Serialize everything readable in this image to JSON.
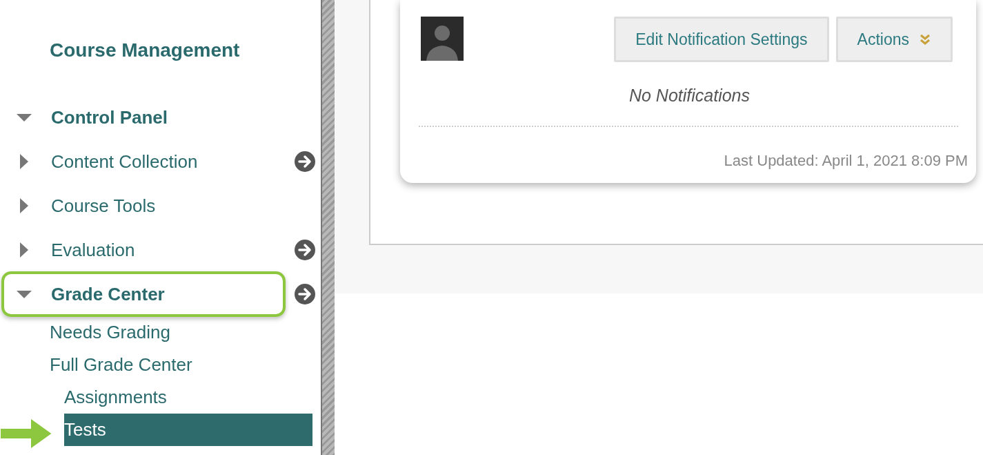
{
  "sidebar": {
    "title": "Course Management",
    "items": [
      {
        "label": "Control Panel",
        "expanded": true,
        "quick_link": false,
        "highlighted": false
      },
      {
        "label": "Content Collection",
        "expanded": false,
        "quick_link": true,
        "highlighted": false
      },
      {
        "label": "Course Tools",
        "expanded": false,
        "quick_link": false,
        "highlighted": false
      },
      {
        "label": "Evaluation",
        "expanded": false,
        "quick_link": true,
        "highlighted": false
      },
      {
        "label": "Grade Center",
        "expanded": true,
        "quick_link": true,
        "highlighted": true,
        "children": [
          {
            "label": "Needs Grading",
            "selected": false,
            "pointed": false
          },
          {
            "label": "Full Grade Center",
            "selected": false,
            "pointed": false,
            "children": [
              {
                "label": "Assignments",
                "selected": false,
                "pointed": false
              },
              {
                "label": "Tests",
                "selected": true,
                "pointed": true
              }
            ]
          }
        ]
      }
    ]
  },
  "notifications": {
    "buttons": [
      {
        "label": "Edit Notification Settings",
        "kind": "plain"
      },
      {
        "label": "Actions",
        "kind": "menu"
      }
    ],
    "empty_message": "No Notifications",
    "last_updated": "Last Updated: April 1, 2021 8:09 PM"
  }
}
